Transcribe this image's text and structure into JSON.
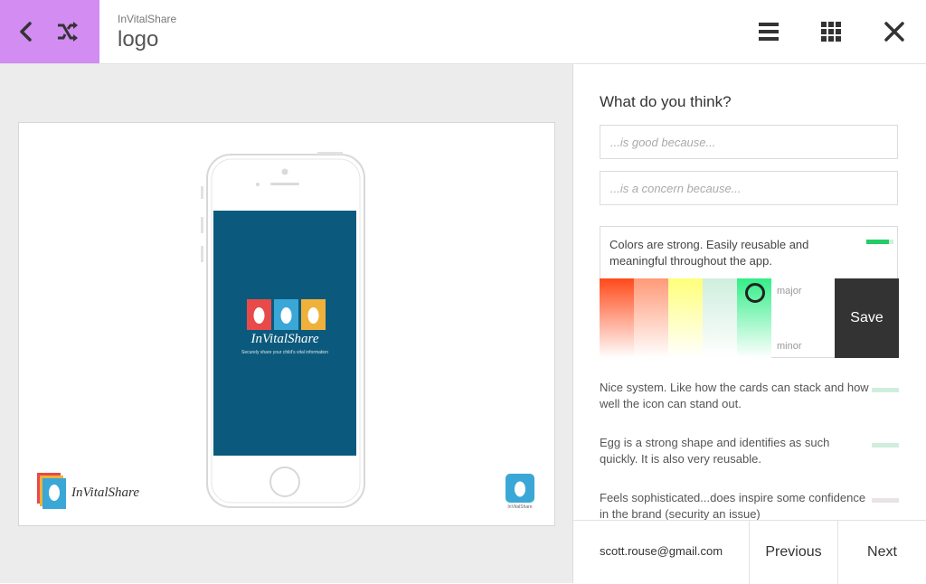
{
  "header": {
    "app_name": "InVitalShare",
    "page_title": "logo",
    "nav_color": "#d28cf2",
    "icons": [
      "back-arrow-icon",
      "shuffle-icon",
      "menu-icon",
      "grid-icon",
      "close-icon"
    ]
  },
  "slide": {
    "brand_name": "InVitalShare",
    "tagline": "Securely share your child's vital information",
    "small_logo_label": "InVitalShare",
    "phone_screen_color": "#0b5a7d",
    "tile_colors": [
      "#e84a4a",
      "#3aa7d6",
      "#f0b13a"
    ]
  },
  "panel": {
    "title": "What do you think?",
    "good_placeholder": "...is good because...",
    "concern_placeholder": "...is a concern because...",
    "active_comment": {
      "text": "Colors are strong. Easily reusable and meaningful throughout the app.",
      "rating": 0.83
    },
    "scale": {
      "major_label": "major",
      "minor_label": "minor",
      "swatches": [
        "#ff4a1a",
        "#ff9a78",
        "#ffff7a",
        "#cfeedd",
        "#33ee88"
      ],
      "selected_index": 4
    },
    "save_label": "Save",
    "comments": [
      {
        "text": "Nice system. Like how the cards can stack and how well the icon can stand out.",
        "color": "#cfeedd"
      },
      {
        "text": "Egg is a strong shape and identifies as such quickly. It is also very reusable.",
        "color": "#cfeedd"
      },
      {
        "text": "Feels sophisticated...does inspire some confidence in the brand (security an issue)",
        "color": "#e9e3e3"
      }
    ]
  },
  "footer": {
    "user_email": "scott.rouse@gmail.com",
    "previous_label": "Previous",
    "next_label": "Next"
  }
}
